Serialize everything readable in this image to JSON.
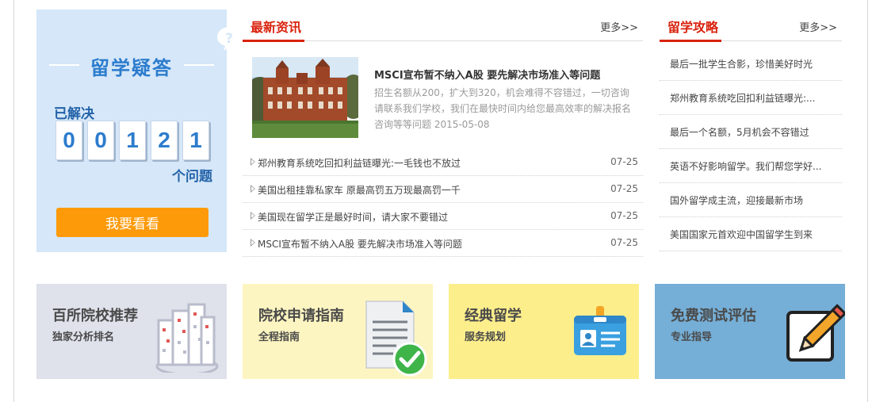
{
  "qa": {
    "title": "留学疑答",
    "solved_label": "已解决",
    "digits": [
      "0",
      "0",
      "1",
      "2",
      "1"
    ],
    "unit_label": "个问题",
    "button_label": "我要看看"
  },
  "news": {
    "tab_label": "最新资讯",
    "more_label": "更多>>",
    "feature": {
      "title": "MSCI宣布暂不纳入A股 要先解决市场准入等问题",
      "description": "招生名额从200，扩大到320，机会难得不容错过，一切咨询请联系我们学校，我们在最快时间内给您最高效率的解决报名咨询等等问题 2015-05-08"
    },
    "items": [
      {
        "title": "郑州教育系统吃回扣利益链曝光:一毛钱也不放过",
        "date": "07-25"
      },
      {
        "title": "美国出租挂靠私家车 原最高罚五万现最高罚一千",
        "date": "07-25"
      },
      {
        "title": "美国现在留学正是最好时间，请大家不要错过",
        "date": "07-25"
      },
      {
        "title": "MSCI宣布暂不纳入A股 要先解决市场准入等问题",
        "date": "07-25"
      }
    ]
  },
  "guide": {
    "tab_label": "留学攻略",
    "more_label": "更多>>",
    "items": [
      "最后一批学生合影，珍惜美好时光",
      "郑州教育系统吃回扣利益链曝光:...",
      "最后一个名额，5月机会不容错过",
      "英语不好影响留学。我们帮您学好...",
      "国外留学成主流，迎接最新市场",
      "美国国家元首欢迎中国留学生到来"
    ]
  },
  "cards": [
    {
      "title": "百所院校推荐",
      "subtitle": "独家分析排名",
      "bg": "#dfe1eb",
      "icon": "buildings-icon"
    },
    {
      "title": "院校申请指南",
      "subtitle": "全程指南",
      "bg": "#fdf5c1",
      "icon": "document-check-icon"
    },
    {
      "title": "经典留学",
      "subtitle": "服务规划",
      "bg": "#fdee8c",
      "icon": "id-card-icon"
    },
    {
      "title": "免费测试评估",
      "subtitle": "专业指导",
      "bg": "#75aed6",
      "icon": "pencil-note-icon"
    }
  ],
  "colors": {
    "accent_red": "#d9230e",
    "accent_blue": "#2c7ccd",
    "button_orange": "#fd9a0a",
    "qa_bg": "#d5e7f8"
  }
}
